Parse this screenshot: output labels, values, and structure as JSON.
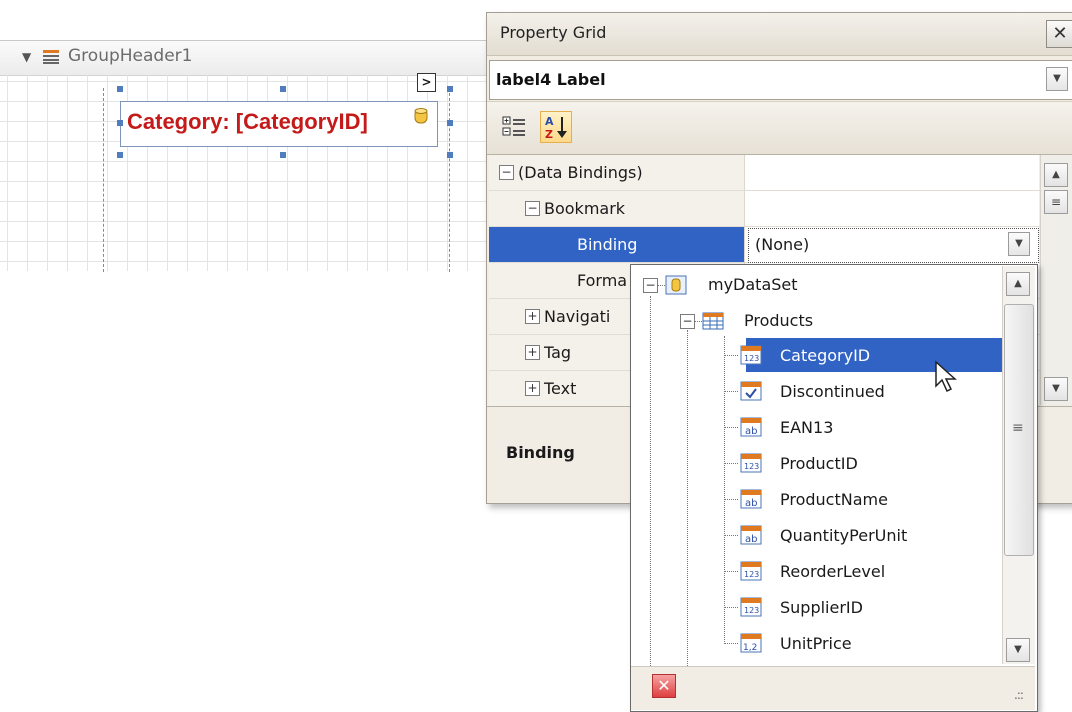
{
  "designer": {
    "band_title": "GroupHeader1",
    "label_text": "Category: [CategoryID]",
    "smart_tag_glyph": ">"
  },
  "property_grid": {
    "title": "Property Grid",
    "close_glyph": "✕",
    "selected_object": "label4  Label",
    "rows": [
      {
        "label": "(Data Bindings)",
        "expander": "−",
        "value": ""
      },
      {
        "label": "Bookmark",
        "expander": "−",
        "value": ""
      },
      {
        "label": "Binding",
        "expander": "",
        "value": "(None)"
      },
      {
        "label": "Forma",
        "expander": "",
        "value": ""
      },
      {
        "label": "Navigati",
        "expander": "+",
        "value": ""
      },
      {
        "label": "Tag",
        "expander": "+",
        "value": ""
      },
      {
        "label": "Text",
        "expander": "+",
        "value": ""
      }
    ],
    "description_title": "Binding",
    "colors": {
      "selection": "#3163c5",
      "accent_text": "#c41a1a"
    }
  },
  "binding_dropdown": {
    "root": "myDataSet",
    "table": "Products",
    "fields": [
      {
        "name": "CategoryID",
        "type_icon": "123"
      },
      {
        "name": "Discontinued",
        "type_icon": "✓"
      },
      {
        "name": "EAN13",
        "type_icon": "ab"
      },
      {
        "name": "ProductID",
        "type_icon": "123"
      },
      {
        "name": "ProductName",
        "type_icon": "ab"
      },
      {
        "name": "QuantityPerUnit",
        "type_icon": "ab"
      },
      {
        "name": "ReorderLevel",
        "type_icon": "123"
      },
      {
        "name": "SupplierID",
        "type_icon": "123"
      },
      {
        "name": "UnitPrice",
        "type_icon": "1,2"
      }
    ],
    "clear_glyph": "✕"
  }
}
